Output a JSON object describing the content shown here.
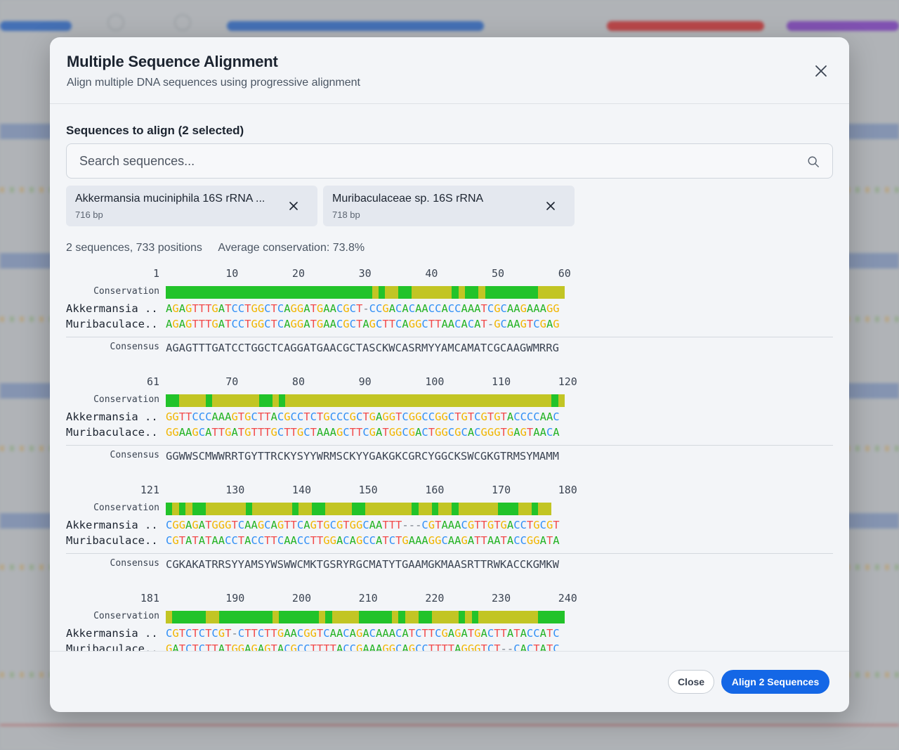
{
  "modal": {
    "title": "Multiple Sequence Alignment",
    "subtitle": "Align multiple DNA sequences using progressive alignment",
    "close_icon": "close-icon"
  },
  "selection": {
    "label": "Sequences to align (2 selected)",
    "search_placeholder": "Search sequences...",
    "search_value": "",
    "chips": [
      {
        "name": "Akkermansia muciniphila 16S rRNA ...",
        "length": "716 bp"
      },
      {
        "name": "Muribaculaceae sp. 16S rRNA",
        "length": "718 bp"
      }
    ]
  },
  "stats": {
    "summary": "2 sequences, 733 positions",
    "conservation": "Average conservation: 73.8%"
  },
  "alignment": {
    "conservation_label": "Conservation",
    "consensus_label": "Consensus",
    "colors": {
      "A": "#22b222",
      "G": "#f1b500",
      "T": "#f24b4b",
      "C": "#2f8ef5",
      "high": "#22c32a",
      "mid": "#c2c524"
    },
    "blocks": [
      {
        "start": "1",
        "ticks": [
          "10",
          "20",
          "30",
          "40",
          "50",
          "60"
        ],
        "conservation": "HHHHHHHHHHHHHHHHHHHHHHHHHHHHHHHMHMMHHMMMMMMHMHHMHHHHHHHHMMMMHM",
        "rows": [
          {
            "name": "Akkermansia ...",
            "seq": "AGAGTTTGATCCTGGCTCAGGATGAACGCT-CCGACACAACCACCAAATCGCAAGAAAGG"
          },
          {
            "name": "Muribaculace...",
            "seq": "AGAGTTTGATCCTGGCTCAGGATGAACGCTAGCTTCAGGCTTAACACAT-GCAAGTCGAG"
          }
        ],
        "consensus": "AGAGTTTGATCCTGGCTCAGGATGAACGCTASCKWCASRMYYAMCAMATCGCAAGWMRRG"
      },
      {
        "start": "61",
        "ticks": [
          "70",
          "80",
          "90",
          "100",
          "110",
          "120"
        ],
        "conservation": "HHMMMMHMMMMMMMHHMHMMMMMMMMMMMMMMMMMMMMMMMMMMMMMMMMMMMMMMMMHM",
        "rows": [
          {
            "name": "Akkermansia ...",
            "seq": "GGTTCCCAAAGTGCTTACGCCTCTGCCCGCTGAGGTCGGCCGGCTGTCGTGTACCCCAAC"
          },
          {
            "name": "Muribaculace...",
            "seq": "GGAAGCATTGATGTTTGCTTGCTAAAGCTTCGATGGCGACTGGCGCACGGGTGAGTAACA"
          }
        ],
        "consensus": "GGWWSCMWWRRTGYTTRCKYSYYWRMSCKYYGAKGKCGRCYGGCKSWCGKGTRMSYMAMM"
      },
      {
        "start": "121",
        "ticks": [
          "130",
          "140",
          "150",
          "160",
          "170",
          "180"
        ],
        "conservation": "HMHMHHMMMMMMHMMMMMMHMMHHMMMMHHMMMMMMMHMMHMMHMMMMMMHHHMMHMM",
        "rows": [
          {
            "name": "Akkermansia ...",
            "seq": "CGGAGATGGGTCAAGCAGTTCAGTGCGTGGCAATTT---CGTAAACGTTGTGACCTGCGT"
          },
          {
            "name": "Muribaculace...",
            "seq": "CGTATATAACCTACCTTCAACCTTGGACAGCCATCTGAAAGGCAAGATTAATACCGGATA"
          }
        ],
        "consensus": "CGKAKATRRSYYAMSYWSWWCMKTGSRYRGCMATYTGAAMGKMAASRTTRWKACCKGMKW"
      },
      {
        "start": "181",
        "ticks": [
          "190",
          "200",
          "210",
          "220",
          "230",
          "240"
        ],
        "conservation": "MHHHHHMMHHHHHHHHMHHHHHHMHMMMMHHHHHMHMMHHMMMMHMHMMMMMMMMMHHHHHMHHHHHH",
        "rows": [
          {
            "name": "Akkermansia ...",
            "seq": "CGTCTCTCGT-CTTCTTGAACGGTCAACAGACAAACATCTTCGAGATGACTTATACCATC"
          },
          {
            "name": "Muribaculace...",
            "seq": "GATCTCTTATGGAGAGTACGCCTTTTACCGAAAGGCAGCCTTTTAGGGTCT--CACTATC"
          }
        ],
        "consensus": ""
      }
    ]
  },
  "footer": {
    "close_label": "Close",
    "align_label": "Align 2 Sequences"
  }
}
